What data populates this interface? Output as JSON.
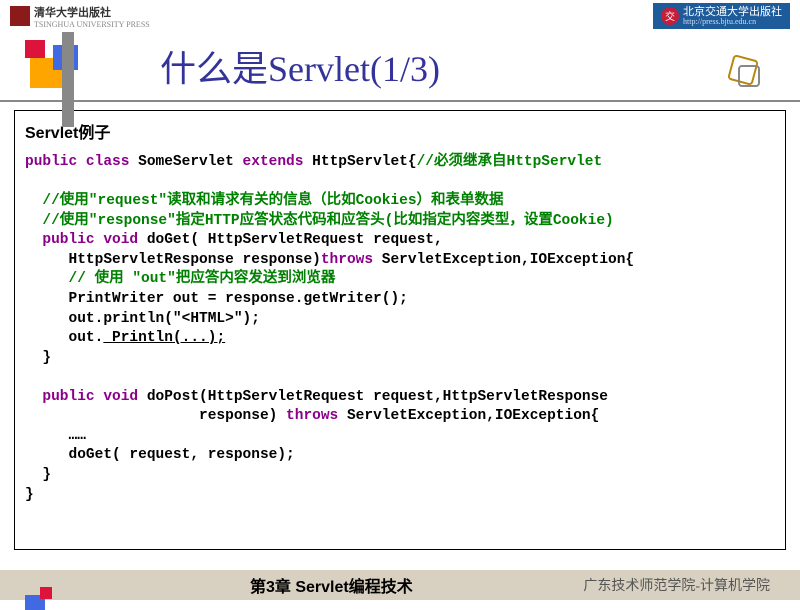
{
  "header": {
    "left_logo_cn": "清华大学出版社",
    "left_logo_en": "TSINGHUA UNIVERSITY PRESS",
    "right_logo_cn": "北京交通大学出版社",
    "right_logo_url": "http://press.bjtu.edu.cn",
    "right_logo_char": "交"
  },
  "title": "什么是Servlet(1/3)",
  "example_title": "Servlet例子",
  "code": {
    "l1_kw1": "public class",
    "l1_name": " SomeServlet ",
    "l1_kw2": "extends",
    "l1_type": " HttpServlet{",
    "l1_cm": "//必须继承自HttpServlet",
    "l2_cm": "  //使用\"request\"读取和请求有关的信息（比如Cookies）和表单数据",
    "l3_cm": "  //使用\"response\"指定HTTP应答状态代码和应答头(比如指定内容类型，设置Cookie)",
    "l4_kw": "  public void",
    "l4_txt": " doGet( HttpServletRequest request,",
    "l5_txt": "     HttpServletResponse response)",
    "l5_kw": "throws",
    "l5_txt2": " ServletException,IOException{",
    "l6_cm": "     // 使用 \"out\"把应答内容发送到浏览器",
    "l7": "     PrintWriter out = response.getWriter();",
    "l8": "     out.println(\"<HTML>\");",
    "l9a": "     out.",
    "l9b": " Println(...);",
    "l10": "  }",
    "l12_kw": "  public void",
    "l12_txt": " doPost(HttpServletRequest request,HttpServletResponse",
    "l13_txt": "                    response) ",
    "l13_kw": "throws",
    "l13_txt2": " ServletException,IOException{",
    "l14": "     ……",
    "l15": "     doGet( request, response);",
    "l16": "  }",
    "l17": "}"
  },
  "footer": {
    "chapter": "第3章 Servlet编程技术",
    "school": "广东技术师范学院-计算机学院"
  }
}
